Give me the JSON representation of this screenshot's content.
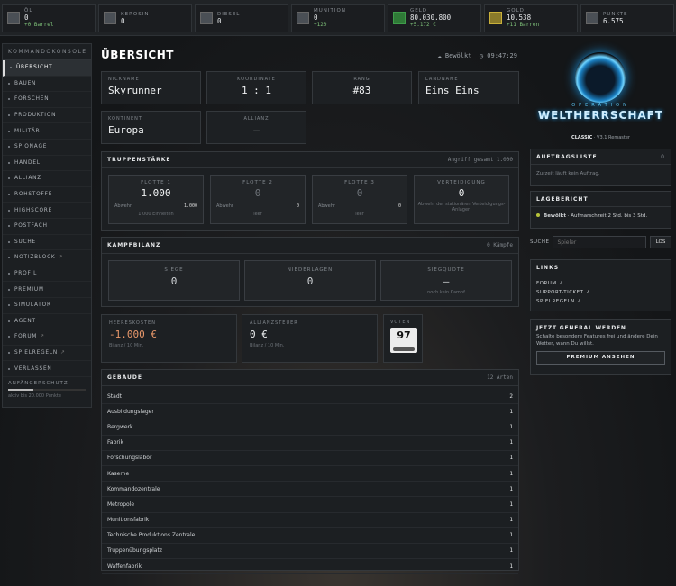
{
  "resources": [
    {
      "label": "Öl",
      "value": "0",
      "sub": "+0 Barrel",
      "icon": "oil-barrel-icon",
      "cls": ""
    },
    {
      "label": "Kerosin",
      "value": "0",
      "sub": "",
      "icon": "kerosene-icon",
      "cls": ""
    },
    {
      "label": "Diesel",
      "value": "0",
      "sub": "",
      "icon": "diesel-icon",
      "cls": ""
    },
    {
      "label": "Munition",
      "value": "0",
      "sub": "+120",
      "icon": "ammo-icon",
      "cls": ""
    },
    {
      "label": "Geld",
      "value": "80.030.800",
      "sub": "+5.172 €",
      "icon": "money-icon",
      "cls": "g"
    },
    {
      "label": "Gold",
      "value": "10.538",
      "sub": "+11 Barren",
      "icon": "gold-icon",
      "cls": "y"
    },
    {
      "label": "Punkte",
      "value": "6.575",
      "sub": "",
      "icon": "points-icon",
      "cls": ""
    }
  ],
  "sidebar": {
    "header": "KOMMANDOKONSOLE",
    "items": [
      {
        "label": "ÜBERSICHT",
        "active": true,
        "ext": false
      },
      {
        "label": "BAUEN",
        "active": false,
        "ext": false
      },
      {
        "label": "FORSCHEN",
        "active": false,
        "ext": false
      },
      {
        "label": "PRODUKTION",
        "active": false,
        "ext": false
      },
      {
        "label": "MILITÄR",
        "active": false,
        "ext": false
      },
      {
        "label": "SPIONAGE",
        "active": false,
        "ext": false
      },
      {
        "label": "HANDEL",
        "active": false,
        "ext": false
      },
      {
        "label": "ALLIANZ",
        "active": false,
        "ext": false
      },
      {
        "label": "ROHSTOFFE",
        "active": false,
        "ext": false
      },
      {
        "label": "HIGHSCORE",
        "active": false,
        "ext": false
      },
      {
        "label": "POSTFACH",
        "active": false,
        "ext": false
      },
      {
        "label": "SUCHE",
        "active": false,
        "ext": false
      },
      {
        "label": "NOTIZBLOCK",
        "active": false,
        "ext": true
      },
      {
        "label": "PROFIL",
        "active": false,
        "ext": false
      },
      {
        "label": "PREMIUM",
        "active": false,
        "ext": false
      },
      {
        "label": "SIMULATOR",
        "active": false,
        "ext": false
      },
      {
        "label": "AGENT",
        "active": false,
        "ext": false
      },
      {
        "label": "FORUM",
        "active": false,
        "ext": true
      },
      {
        "label": "SPIELREGELN",
        "active": false,
        "ext": true
      },
      {
        "label": "VERLASSEN",
        "active": false,
        "ext": false
      }
    ],
    "beginner_label": "ANFÄNGERSCHUTZ",
    "beginner_progress": 0.33,
    "beginner_text": "aktiv bis 20.000 Punkte"
  },
  "page_title": "ÜBERSICHT",
  "weather": "☁ Bewölkt",
  "clock": "◷ 09:47:29",
  "info": {
    "nickname_label": "NICKNAME",
    "nickname": "Skyrunner",
    "koord_label": "KOORDINATE",
    "koord": "1 : 1",
    "rang_label": "RANG",
    "rang": "#83",
    "land_label": "LANDNAME",
    "land": "Eins Eins",
    "kontinent_label": "KONTINENT",
    "kontinent": "Europa",
    "allianz_label": "ALLIANZ",
    "allianz": "–"
  },
  "troops": {
    "title": "TRUPPENSTÄRKE",
    "right": "Angriff gesamt 1.000",
    "fleets": [
      {
        "label": "FLOTTE 1",
        "value": "1.000",
        "abw_label": "Abwehr",
        "abw": "1.000",
        "foot": "1.000 Einheiten",
        "dim": false
      },
      {
        "label": "FLOTTE 2",
        "value": "0",
        "abw_label": "Abwehr",
        "abw": "0",
        "foot": "leer",
        "dim": true
      },
      {
        "label": "FLOTTE 3",
        "value": "0",
        "abw_label": "Abwehr",
        "abw": "0",
        "foot": "leer",
        "dim": true
      },
      {
        "label": "VERTEIDIGUNG",
        "value": "0",
        "abw_label": "",
        "abw": "",
        "foot": "Abwehr der stationären Verteidigungs-Anlagen",
        "dim": false
      }
    ]
  },
  "combat": {
    "title": "KAMPFBILANZ",
    "right": "0 Kämpfe",
    "boxes": [
      {
        "label": "SIEGE",
        "value": "0",
        "foot": ""
      },
      {
        "label": "NIEDERLAGEN",
        "value": "0",
        "foot": ""
      },
      {
        "label": "SIEGQUOTE",
        "value": "–",
        "foot": "noch kein Kampf"
      }
    ]
  },
  "money": {
    "heer_label": "HEERESKOSTEN",
    "heer": "-1.000 €",
    "heer_foot": "Bilanz / 10 Min.",
    "steuer_label": "ALLIANZSTEUER",
    "steuer": "0 €",
    "steuer_foot": "Bilanz / 10 Min.",
    "vote_label": "VOTEN",
    "vote": "97"
  },
  "buildings": {
    "title": "GEBÄUDE",
    "right": "12 Arten",
    "rows": [
      {
        "name": "Stadt",
        "count": "2"
      },
      {
        "name": "Ausbildungslager",
        "count": "1"
      },
      {
        "name": "Bergwerk",
        "count": "1"
      },
      {
        "name": "Fabrik",
        "count": "1"
      },
      {
        "name": "Forschungslabor",
        "count": "1"
      },
      {
        "name": "Kaserne",
        "count": "1"
      },
      {
        "name": "Kommandozentrale",
        "count": "1"
      },
      {
        "name": "Metropole",
        "count": "1"
      },
      {
        "name": "Munitionsfabrik",
        "count": "1"
      },
      {
        "name": "Technische Produktions Zentrale",
        "count": "1"
      },
      {
        "name": "Truppenübungsplatz",
        "count": "1"
      },
      {
        "name": "Waffenfabrik",
        "count": "1"
      }
    ]
  },
  "logo": {
    "op": "OPERATION",
    "wh": "WELTHERRSCHAFT",
    "classic": "CLASSIC",
    "version": " · V3.1 Remaster"
  },
  "auftrag": {
    "title": "AUFTRAGSLISTE",
    "count": "0",
    "text": "Zurzeit läuft kein Auftrag."
  },
  "lage": {
    "title": "LAGEBERICHT",
    "strong": "Bewölkt",
    "text": " · Aufmarschzeit 2 Std. bis 3 Std."
  },
  "search": {
    "label": "SUCHE",
    "placeholder": "Spieler",
    "button": "LOS"
  },
  "links": {
    "title": "LINKS",
    "items": [
      "FORUM ↗",
      "SUPPORT-TICKET ↗",
      "SPIELREGELN ↗"
    ]
  },
  "general": {
    "title": "JETZT GENERAL WERDEN",
    "text": "Schalte besondere Features frei und ändere Dein Wetter, wann Du willst.",
    "button": "PREMIUM ANSEHEN"
  },
  "colors": {
    "accent": "#1a8fd8",
    "negative": "#e8976a",
    "positive": "#7fc27a"
  }
}
